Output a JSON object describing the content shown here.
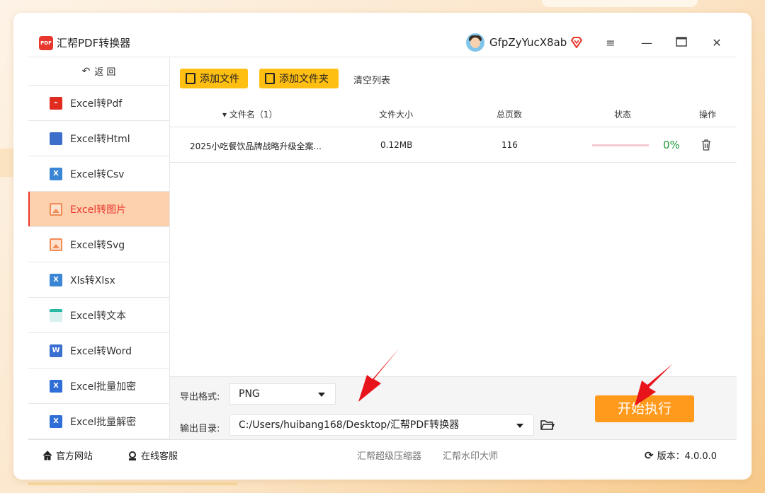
{
  "app": {
    "title": "汇帮PDF转换器",
    "logo_text": "PDF"
  },
  "user": {
    "name": "GfpZyYucX8ab"
  },
  "sidebar": {
    "back_label": "返  回",
    "items": [
      {
        "label": "Excel转Pdf",
        "icon": "pdf-icon"
      },
      {
        "label": "Excel转Html",
        "icon": "html-icon"
      },
      {
        "label": "Excel转Csv",
        "icon": "excel-icon"
      },
      {
        "label": "Excel转图片",
        "icon": "image-icon"
      },
      {
        "label": "Excel转Svg",
        "icon": "image-icon"
      },
      {
        "label": "Xls转Xlsx",
        "icon": "excel-icon"
      },
      {
        "label": "Excel转文本",
        "icon": "text-icon"
      },
      {
        "label": "Excel转Word",
        "icon": "word-icon"
      },
      {
        "label": "Excel批量加密",
        "icon": "xls-icon"
      },
      {
        "label": "Excel批量解密",
        "icon": "xls-icon"
      }
    ],
    "active_index": 3
  },
  "toolbar": {
    "add_file": "添加文件",
    "add_folder": "添加文件夹",
    "clear": "清空列表"
  },
  "table": {
    "headers": {
      "name": "文件名（1）",
      "size": "文件大小",
      "pages": "总页数",
      "status": "状态",
      "action": "操作"
    },
    "rows": [
      {
        "name": "2025小吃餐饮品牌战略升级全案...",
        "size": "0.12MB",
        "pages": "116",
        "progress_pct": "0%"
      }
    ]
  },
  "export": {
    "format_label": "导出格式:",
    "format_value": "PNG",
    "dir_label": "输出目录:",
    "dir_value": "C:/Users/huibang168/Desktop/汇帮PDF转换器",
    "start": "开始执行"
  },
  "footer": {
    "website": "官方网站",
    "support": "在线客服",
    "link1": "汇帮超级压缩器",
    "link2": "汇帮水印大师",
    "version": "版本：4.0.0.0"
  },
  "colors": {
    "accent": "#ffbe12",
    "start": "#ff9a1c",
    "active_bg": "#fdd0ae",
    "active_text": "#e8372c",
    "progress": "#1f9a3b"
  }
}
